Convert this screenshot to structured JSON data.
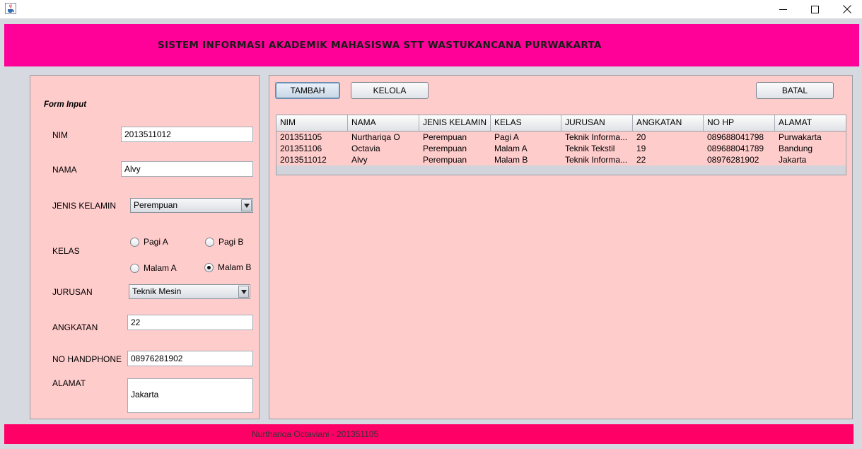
{
  "window": {
    "icons": {
      "app": "java-cup-icon",
      "minimize": "minimize-icon",
      "maximize": "maximize-icon",
      "close": "close-icon"
    }
  },
  "banner": {
    "title": "SISTEM INFORMASI AKADEMIK MAHASISWA STT WASTUKANCANA PURWAKARTA",
    "color": "#ff0099"
  },
  "form": {
    "title": "Form Input",
    "nim": {
      "label": "NIM",
      "value": "2013511012"
    },
    "nama": {
      "label": "NAMA",
      "value": "Alvy"
    },
    "jenis_kelamin": {
      "label": "JENIS KELAMIN",
      "value": "Perempuan"
    },
    "kelas": {
      "label": "KELAS",
      "options": [
        "Pagi A",
        "Pagi B",
        "Malam A",
        "Malam B"
      ],
      "selected": "Malam B"
    },
    "jurusan": {
      "label": "JURUSAN",
      "value": "Teknik Mesin"
    },
    "angkatan": {
      "label": "ANGKATAN",
      "value": "22"
    },
    "no_hp": {
      "label": "NO HANDPHONE",
      "value": "08976281902"
    },
    "alamat": {
      "label": "ALAMAT",
      "value": "Jakarta"
    }
  },
  "toolbar": {
    "tambah": "TAMBAH",
    "kelola": "KELOLA",
    "batal": "BATAL"
  },
  "table": {
    "columns": [
      "NIM",
      "NAMA",
      "JENIS KELAMIN",
      "KELAS",
      "JURUSAN",
      "ANGKATAN",
      "NO HP",
      "ALAMAT"
    ],
    "rows": [
      [
        "201351105",
        "Nurthariqa O",
        "Perempuan",
        "Pagi A",
        "Teknik Informa...",
        "20",
        "089688041798",
        "Purwakarta"
      ],
      [
        "201351106",
        "Octavia",
        "Perempuan",
        "Malam A",
        "Teknik Tekstil",
        "19",
        "089688041789",
        "Bandung"
      ],
      [
        "2013511012",
        "Alvy",
        "Perempuan",
        "Malam B",
        "Teknik Informa...",
        "22",
        "08976281902",
        "Jakarta"
      ]
    ]
  },
  "footer": {
    "text": "Nurthariqa Octaviani - 201351105",
    "color": "#ff0066"
  },
  "colors": {
    "panel": "#ffcccc",
    "background": "#d6d9df"
  }
}
